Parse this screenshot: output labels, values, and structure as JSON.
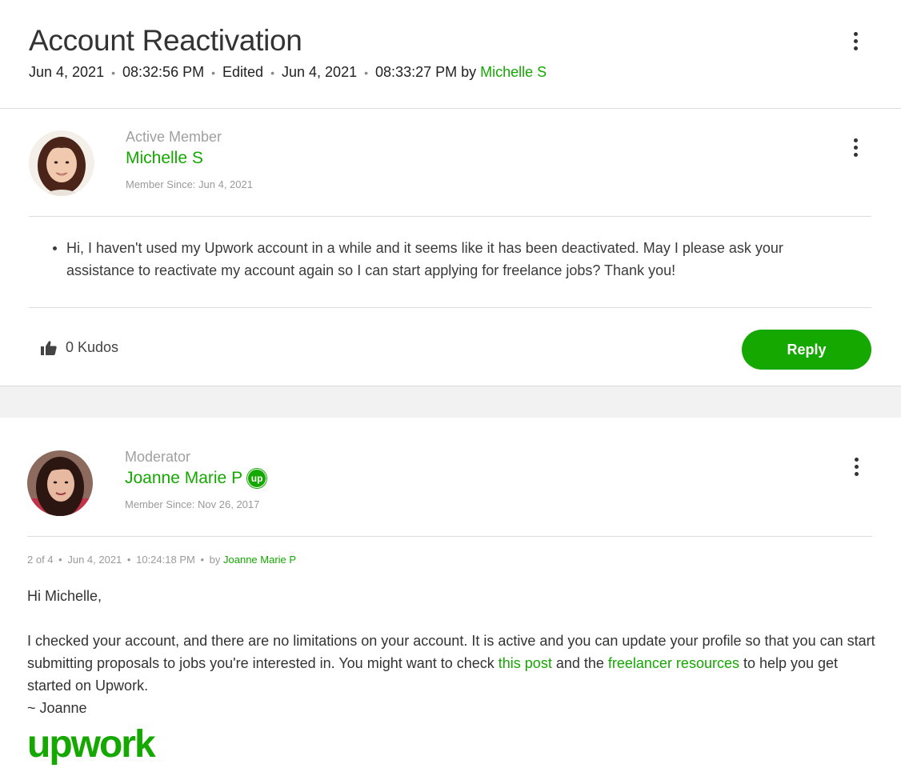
{
  "thread": {
    "title": "Account Reactivation",
    "date": "Jun 4, 2021",
    "time": "08:32:56 PM",
    "edited_label": "Edited",
    "edited_date": "Jun 4, 2021",
    "edited_time": "08:33:27 PM",
    "by_label": "by",
    "by_author": "Michelle S",
    "separator": "•"
  },
  "post": {
    "rank": "Active Member",
    "author": "Michelle S",
    "member_since": "Member Since: Jun 4, 2021",
    "body": "Hi, I haven't used my Upwork account in a while and it seems like it has been deactivated. May I please ask your assistance to reactivate my account again so I can start applying for freelance jobs? Thank you!",
    "kudos": "0 Kudos",
    "reply_label": "Reply",
    "kudos_icon": "thumbs-up-icon",
    "avatar_icon": "avatar-michelle"
  },
  "reply": {
    "rank": "Moderator",
    "author": "Joanne Marie P",
    "badge_text": "up",
    "member_since": "Member Since: Nov 26, 2017",
    "position": "2 of 4",
    "date": "Jun 4, 2021",
    "time": "10:24:18 PM",
    "by_label": "by",
    "by_author": "Joanne Marie P",
    "greeting": "Hi Michelle,",
    "body_part1": "I checked your account, and there are no limitations on your account. It is active and you can update your profile so that you can start submitting proposals to jobs you're interested in. You might want to check ",
    "link1": "this post",
    "body_part2": " and the ",
    "link2": "freelancer resources",
    "body_part3": " to help you get started on Upwork.",
    "signoff": "~ Joanne",
    "logo_text": "upwork",
    "avatar_icon": "avatar-joanne"
  },
  "colors": {
    "brand_green": "#14a800",
    "muted_gray": "#9a9a9a",
    "band_gray": "#f2f2f2"
  }
}
